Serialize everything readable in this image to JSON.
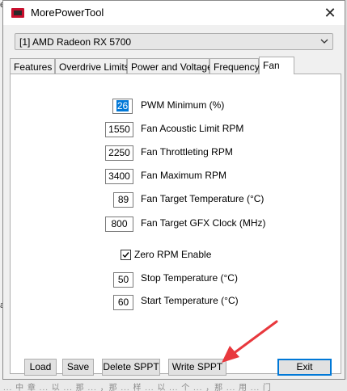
{
  "background": {
    "left_text_top": "es",
    "left_text_mid": "ac",
    "left_text_bottom": "说",
    "bottom_text": "... 中 章 ... 以 ... 那 ... ，那 ... 样 ... 以 ... 个 ... ，那 ... 用 ... 门"
  },
  "window": {
    "title": "MorePowerTool",
    "close_glyph": "✕"
  },
  "gpu_select": {
    "value": "[1] AMD Radeon RX 5700"
  },
  "tabs": [
    {
      "label": "Features",
      "active": false
    },
    {
      "label": "Overdrive Limits",
      "active": false
    },
    {
      "label": "Power and Voltage",
      "active": false
    },
    {
      "label": "Frequency",
      "active": false
    },
    {
      "label": "Fan",
      "active": true
    }
  ],
  "fan": {
    "pwm_minimum": {
      "value": "26",
      "label": "PWM Minimum (%)"
    },
    "acoustic_limit": {
      "value": "1550",
      "label": "Fan Acoustic Limit RPM"
    },
    "throttling_rpm": {
      "value": "2250",
      "label": "Fan Throttleting RPM"
    },
    "maximum_rpm": {
      "value": "3400",
      "label": "Fan Maximum RPM"
    },
    "target_temperature": {
      "value": "89",
      "label": "Fan Target Temperature (°C)"
    },
    "target_gfx_clock": {
      "value": "800",
      "label": "Fan Target GFX Clock (MHz)"
    },
    "zero_rpm": {
      "label": "Zero RPM Enable",
      "checked": true
    },
    "stop_temperature": {
      "value": "50",
      "label": "Stop Temperature (°C)"
    },
    "start_temperature": {
      "value": "60",
      "label": "Start Temperature (°C)"
    }
  },
  "buttons": {
    "load": "Load",
    "save": "Save",
    "delete_sppt": "Delete SPPT",
    "write_sppt": "Write SPPT",
    "exit": "Exit"
  },
  "colors": {
    "annotation_arrow": "#e8383d",
    "selection": "#0078d7",
    "app_icon": "#c8102e"
  },
  "icons": {
    "app": "app-icon",
    "close": "close-icon",
    "dropdown": "chevron-down-icon",
    "checkbox": "checkmark-icon",
    "annotation": "arrow-annotation"
  }
}
